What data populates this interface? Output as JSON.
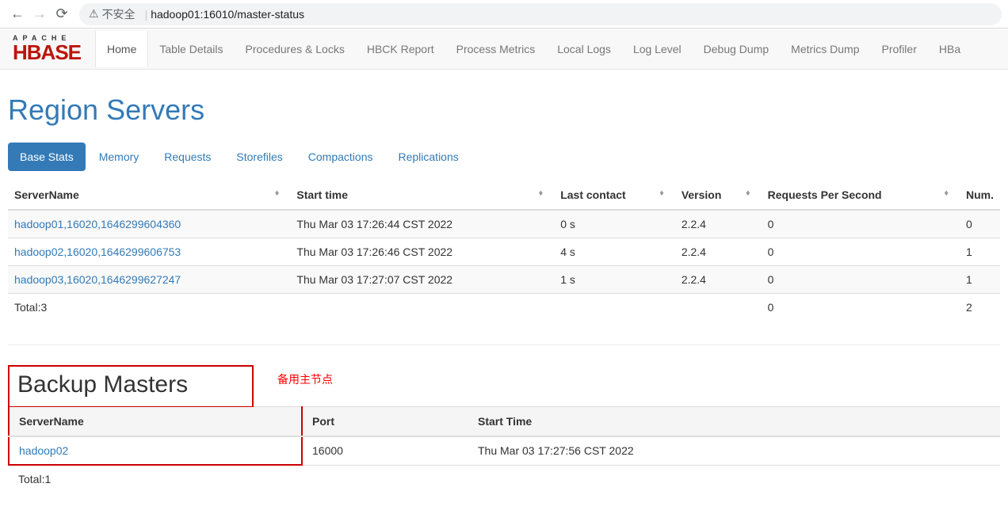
{
  "browser": {
    "insecure_label": "不安全",
    "url": "hadoop01:16010/master-status"
  },
  "nav": {
    "items": [
      "Home",
      "Table Details",
      "Procedures & Locks",
      "HBCK Report",
      "Process Metrics",
      "Local Logs",
      "Log Level",
      "Debug Dump",
      "Metrics Dump",
      "Profiler",
      "HBa"
    ]
  },
  "region_servers": {
    "title": "Region Servers",
    "tabs": [
      "Base Stats",
      "Memory",
      "Requests",
      "Storefiles",
      "Compactions",
      "Replications"
    ],
    "headers": {
      "server": "ServerName",
      "start": "Start time",
      "last": "Last contact",
      "version": "Version",
      "rps": "Requests Per Second",
      "num": "Num."
    },
    "rows": [
      {
        "server": "hadoop01,16020,1646299604360",
        "start": "Thu Mar 03 17:26:44 CST 2022",
        "last": "0 s",
        "version": "2.2.4",
        "rps": "0",
        "num": "0"
      },
      {
        "server": "hadoop02,16020,1646299606753",
        "start": "Thu Mar 03 17:26:46 CST 2022",
        "last": "4 s",
        "version": "2.2.4",
        "rps": "0",
        "num": "1"
      },
      {
        "server": "hadoop03,16020,1646299627247",
        "start": "Thu Mar 03 17:27:07 CST 2022",
        "last": "1 s",
        "version": "2.2.4",
        "rps": "0",
        "num": "1"
      }
    ],
    "total": {
      "label": "Total:3",
      "rps": "0",
      "num": "2"
    }
  },
  "backup": {
    "title": "Backup Masters",
    "annotation": "备用主节点",
    "headers": {
      "server": "ServerName",
      "port": "Port",
      "start": "Start Time"
    },
    "rows": [
      {
        "server": "hadoop02",
        "port": "16000",
        "start": "Thu Mar 03 17:27:56 CST 2022"
      }
    ],
    "total": "Total:1"
  }
}
